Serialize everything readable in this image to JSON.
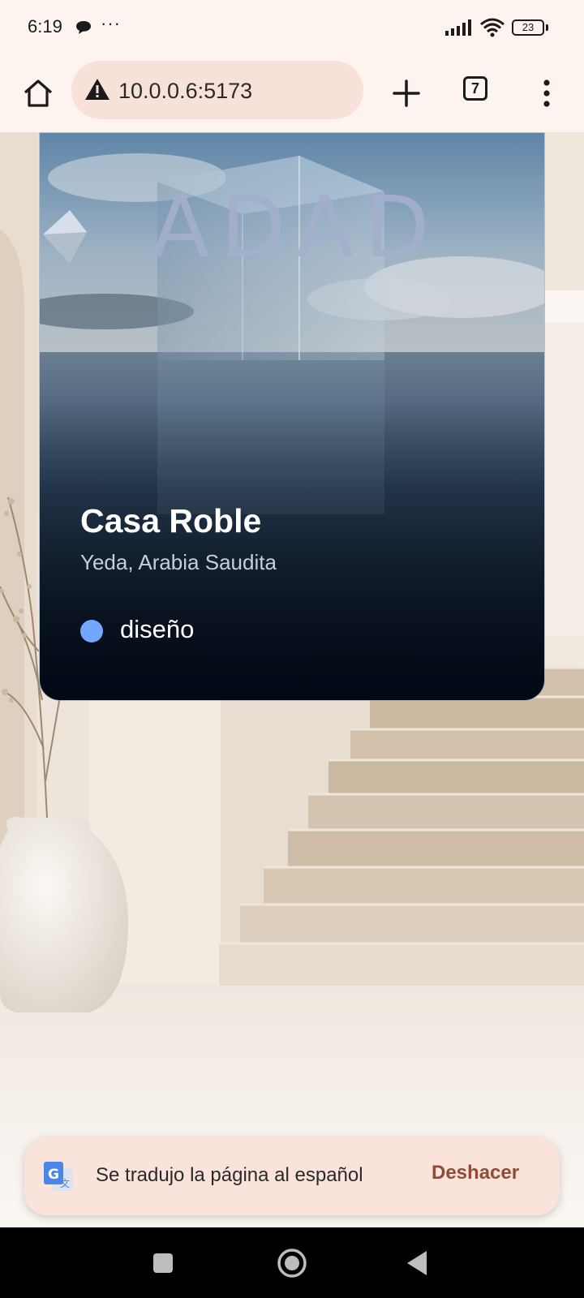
{
  "status_bar": {
    "time": "6:19",
    "more_indicator": "···",
    "battery_level": "23"
  },
  "browser": {
    "url": "10.0.0.6:5173",
    "tab_count": "7"
  },
  "card": {
    "logo_text": "ADAD",
    "title": "Casa Roble",
    "location": "Yeda, Arabia Saudita",
    "tag": {
      "label": "diseño",
      "color": "#73a6ff"
    }
  },
  "translate_bar": {
    "message": "Se tradujo la página al español",
    "undo_label": "Deshacer"
  },
  "colors": {
    "accent_undo": "#8f4c36",
    "toolbar_bg": "#fdf3ef",
    "url_bar_bg": "#f8e1d8"
  }
}
